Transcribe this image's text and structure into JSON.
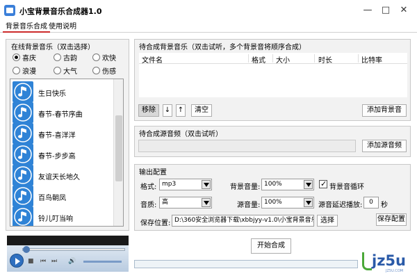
{
  "window": {
    "title": "小宝背景音乐合成器1.0",
    "minimize": "—",
    "maximize": "□",
    "close": "✕"
  },
  "tabs": [
    {
      "label": "背景音乐合成",
      "active": true
    },
    {
      "label": "使用说明",
      "active": false
    }
  ],
  "online_music": {
    "title": "在线背景音乐（双击选择）",
    "categories": [
      {
        "label": "喜庆",
        "checked": true
      },
      {
        "label": "古韵",
        "checked": false
      },
      {
        "label": "欢快",
        "checked": false
      },
      {
        "label": "浪漫",
        "checked": false
      },
      {
        "label": "大气",
        "checked": false
      },
      {
        "label": "伤感",
        "checked": false
      }
    ],
    "songs": [
      "生日快乐",
      "春节-春节序曲",
      "春节-喜洋洋",
      "春节-步步高",
      "友谊天长地久",
      "百鸟朝凤",
      "铃儿叮当响"
    ]
  },
  "bg_music": {
    "title": "待合成背景音乐（双击试听，多个背景音将顺序合成）",
    "columns": [
      "文件名",
      "格式",
      "大小",
      "时长",
      "比特率"
    ],
    "remove_label": "移除",
    "down_label": "↓",
    "up_label": "↑",
    "clear_label": "清空",
    "add_label": "添加背景音"
  },
  "source_audio": {
    "title": "待合成源音频（双击试听）",
    "add_label": "添加源音频"
  },
  "output": {
    "title": "输出配置",
    "format_label": "格式:",
    "format_value": "mp3",
    "bg_volume_label": "背景音量:",
    "bg_volume_value": "100%",
    "loop_label": "背景音循环",
    "loop_checked": true,
    "quality_label": "音质:",
    "quality_value": "高",
    "src_volume_label": "源音量:",
    "src_volume_value": "100%",
    "delay_label": "源音延迟播放:",
    "delay_value": "0",
    "delay_unit": "秒",
    "save_label": "保存位置:",
    "save_value": "D:\\360安全浏览器下载\\xbbjyy-v1.0\\小宝背景音乐",
    "choose_label": "选择",
    "save_config_label": "保存配置"
  },
  "start_label": "开始合成",
  "watermark": {
    "text": "jz5u",
    "sub": "JZ5U.COM"
  }
}
